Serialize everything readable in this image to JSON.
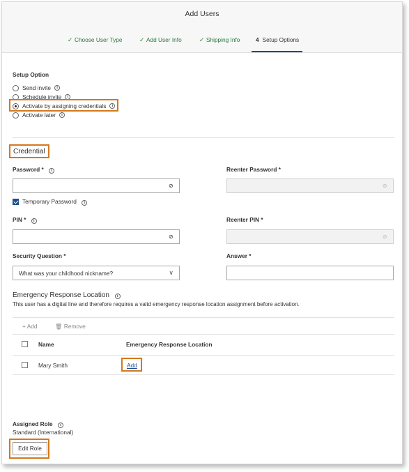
{
  "header": {
    "title": "Add Users",
    "steps": [
      {
        "label": "Choose User Type",
        "mark": "✓"
      },
      {
        "label": "Add User Info",
        "mark": "✓"
      },
      {
        "label": "Shipping Info",
        "mark": "✓"
      },
      {
        "label": "Setup Options",
        "mark": "4"
      }
    ]
  },
  "setup": {
    "label": "Setup Option",
    "options": [
      {
        "label": "Send invite",
        "selected": false
      },
      {
        "label": "Schedule invite",
        "selected": false
      },
      {
        "label": "Activate by assigning credentials",
        "selected": true
      },
      {
        "label": "Activate later",
        "selected": false
      }
    ]
  },
  "credential": {
    "heading": "Credential",
    "password_label": "Password *",
    "reenter_password_label": "Reenter Password *",
    "temporary_password_label": "Temporary Password",
    "temporary_password_checked": true,
    "pin_label": "PIN *",
    "reenter_pin_label": "Reenter PIN *",
    "security_question_label": "Security Question *",
    "security_question_value": "What was your childhood nickname?",
    "answer_label": "Answer *"
  },
  "erl": {
    "heading": "Emergency Response Location",
    "description": "This user has a digital line and therefore requires a valid emergency response location assignment before activation.",
    "add_label": "Add",
    "remove_label": "Remove",
    "columns": [
      "Name",
      "Emergency Response Location"
    ],
    "rows": [
      {
        "name": "Mary Smith",
        "action": "Add"
      }
    ]
  },
  "role": {
    "label": "Assigned Role",
    "value": "Standard (International)",
    "edit_label": "Edit Role"
  },
  "colors": {
    "highlight": "#d4781c",
    "done_step": "#2a7a38",
    "accent": "#0a4a8b"
  }
}
